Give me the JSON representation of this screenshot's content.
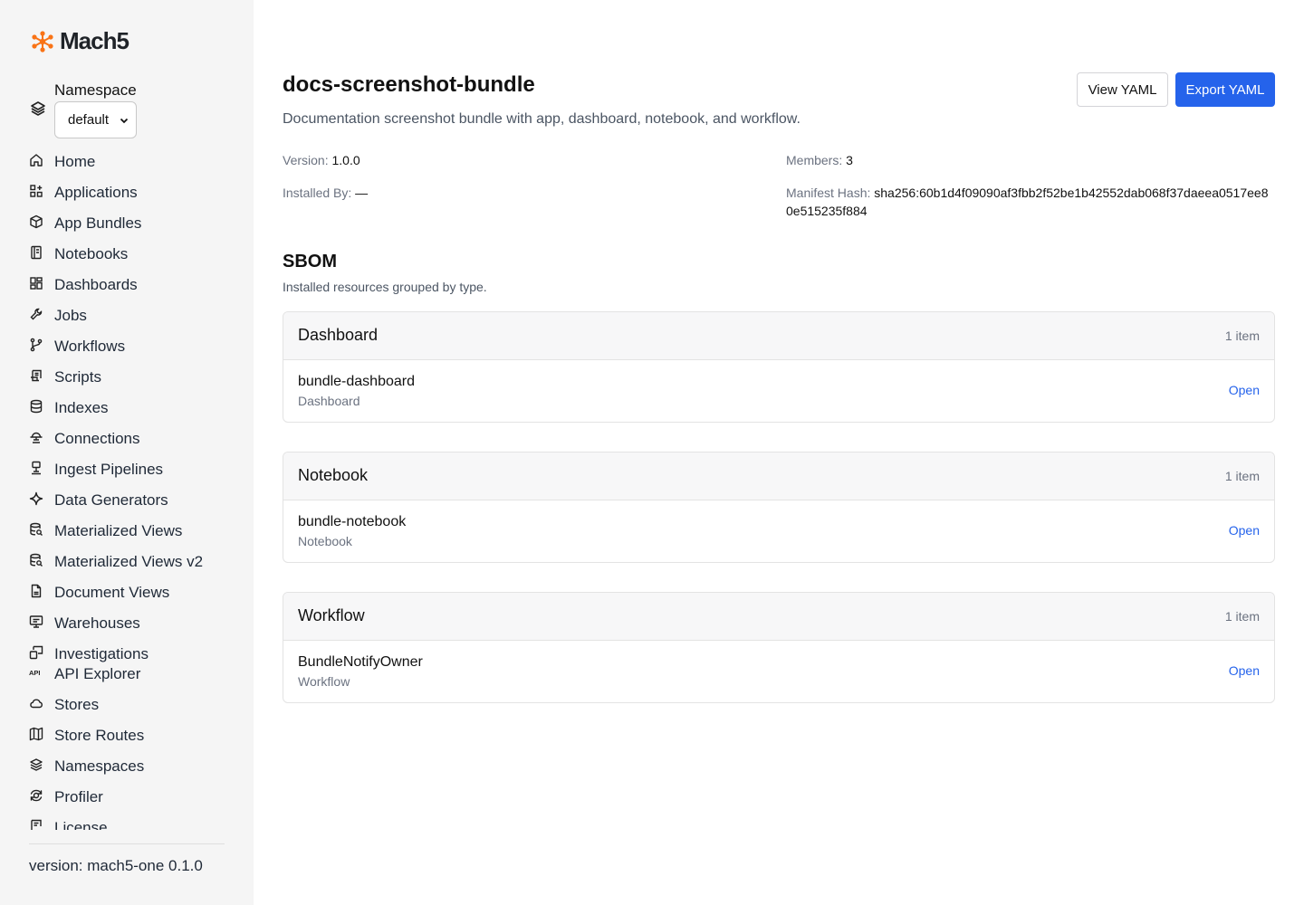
{
  "app": {
    "name": "Mach5",
    "brand_color": "#f97316",
    "accent_color": "#2563eb"
  },
  "sidebar": {
    "namespace_label": "Namespace",
    "namespace_value": "default",
    "items": [
      {
        "label": "Home",
        "icon": "home-icon"
      },
      {
        "label": "Applications",
        "icon": "grid-plus-icon"
      },
      {
        "label": "App Bundles",
        "icon": "package-icon"
      },
      {
        "label": "Notebooks",
        "icon": "notebook-icon"
      },
      {
        "label": "Dashboards",
        "icon": "dashboard-icon"
      },
      {
        "label": "Jobs",
        "icon": "wrench-icon"
      },
      {
        "label": "Workflows",
        "icon": "git-branch-icon"
      },
      {
        "label": "Scripts",
        "icon": "script-icon"
      },
      {
        "label": "Indexes",
        "icon": "database-icon"
      },
      {
        "label": "Connections",
        "icon": "connection-icon"
      },
      {
        "label": "Ingest Pipelines",
        "icon": "pipeline-icon"
      },
      {
        "label": "Data Generators",
        "icon": "sparkle-icon"
      },
      {
        "label": "Materialized Views",
        "icon": "database-search-icon"
      },
      {
        "label": "Materialized Views v2",
        "icon": "database-search-icon"
      },
      {
        "label": "Document Views",
        "icon": "document-icon"
      },
      {
        "label": "Warehouses",
        "icon": "warehouse-icon"
      },
      {
        "label": "Investigations",
        "icon": "investigation-icon"
      },
      {
        "label": "API Explorer",
        "icon": "api-icon"
      },
      {
        "label": "Stores",
        "icon": "cloud-icon"
      },
      {
        "label": "Store Routes",
        "icon": "map-icon"
      },
      {
        "label": "Namespaces",
        "icon": "layers-icon"
      },
      {
        "label": "Profiler",
        "icon": "profiler-icon"
      },
      {
        "label": "License",
        "icon": "license-icon"
      }
    ],
    "version": "version: mach5-one 0.1.0"
  },
  "page": {
    "title": "docs-screenshot-bundle",
    "description": "Documentation screenshot bundle with app, dashboard, notebook, and workflow.",
    "view_yaml_label": "View YAML",
    "export_yaml_label": "Export YAML",
    "meta": {
      "version_label": "Version:",
      "version_value": "1.0.0",
      "members_label": "Members:",
      "members_value": "3",
      "installed_by_label": "Installed By:",
      "installed_by_value": "—",
      "manifest_hash_label": "Manifest Hash:",
      "manifest_hash_value": "sha256:60b1d4f09090af3fbb2f52be1b42552dab068f37daeea0517ee80e515235f884"
    }
  },
  "sbom": {
    "title": "SBOM",
    "subtitle": "Installed resources grouped by type.",
    "groups": [
      {
        "type": "Dashboard",
        "count": "1 item",
        "resource_name": "bundle-dashboard",
        "resource_type": "Dashboard",
        "action": "Open"
      },
      {
        "type": "Notebook",
        "count": "1 item",
        "resource_name": "bundle-notebook",
        "resource_type": "Notebook",
        "action": "Open"
      },
      {
        "type": "Workflow",
        "count": "1 item",
        "resource_name": "BundleNotifyOwner",
        "resource_type": "Workflow",
        "action": "Open"
      }
    ]
  }
}
